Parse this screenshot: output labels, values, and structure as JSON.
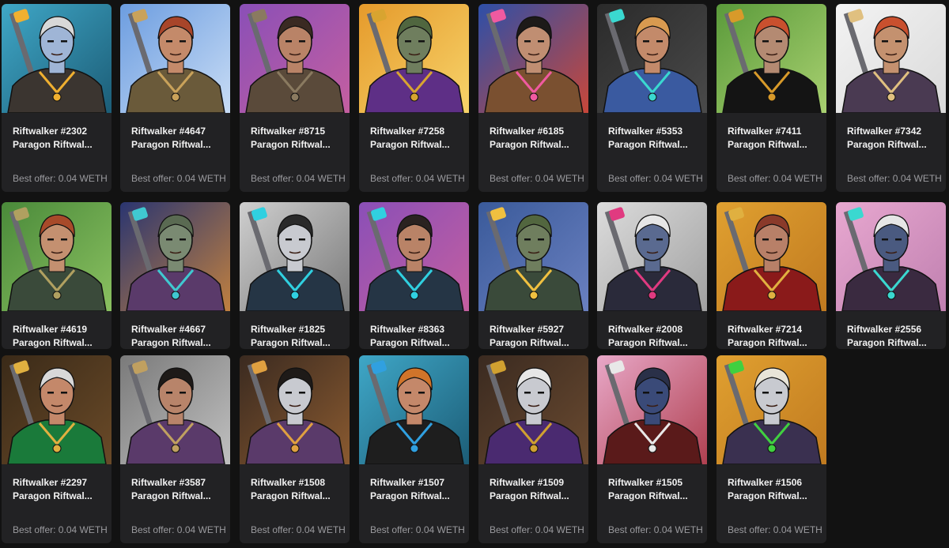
{
  "offer_prefix": "Best offer:",
  "cards": [
    {
      "title": "Riftwalker #2302",
      "subtitle": "Paragon Riftwal...",
      "offer": "Best offer: 0.04 WETH",
      "bg": "#3fa7c7",
      "bg2": "#1c5d77",
      "skin": "#9fb5d6",
      "hair": "#d8d8d8",
      "outfit": "#3b3530",
      "accent": "#f0b030"
    },
    {
      "title": "Riftwalker #4647",
      "subtitle": "Paragon Riftwal...",
      "offer": "Best offer: 0.04 WETH",
      "bg": "#6c9de0",
      "bg2": "#c8dcf5",
      "skin": "#c48a6a",
      "hair": "#a8452a",
      "outfit": "#6a5a3a",
      "accent": "#c9a25a"
    },
    {
      "title": "Riftwalker #8715",
      "subtitle": "Paragon Riftwal...",
      "offer": "Best offer: 0.04 WETH",
      "bg": "#8a4fb7",
      "bg2": "#c45fa0",
      "skin": "#b98367",
      "hair": "#3a2a22",
      "outfit": "#5a4a3a",
      "accent": "#8a7a60"
    },
    {
      "title": "Riftwalker #7258",
      "subtitle": "Paragon Riftwal...",
      "offer": "Best offer: 0.04 WETH",
      "bg": "#e59a2b",
      "bg2": "#f7d36a",
      "skin": "#6f7e5e",
      "hair": "#50663f",
      "outfit": "#5e2f86",
      "accent": "#d8a430"
    },
    {
      "title": "Riftwalker #6185",
      "subtitle": "Paragon Riftwal...",
      "offer": "Best offer: 0.04 WETH",
      "bg": "#2d4fa8",
      "bg2": "#c8473a",
      "skin": "#c08e72",
      "hair": "#1d1a18",
      "outfit": "#7a5030",
      "accent": "#f05aa0"
    },
    {
      "title": "Riftwalker #5353",
      "subtitle": "Paragon Riftwal...",
      "offer": "Best offer: 0.04 WETH",
      "bg": "#2a2a2a",
      "bg2": "#4a4a4a",
      "skin": "#c38a6a",
      "hair": "#d89a50",
      "outfit": "#3a5aa0",
      "accent": "#3ad8d0"
    },
    {
      "title": "Riftwalker #7411",
      "subtitle": "Paragon Riftwal...",
      "offer": "Best offer: 0.04 WETH",
      "bg": "#5a9a3a",
      "bg2": "#a8d070",
      "skin": "#b48a72",
      "hair": "#c9502e",
      "outfit": "#141414",
      "accent": "#d89a2a"
    },
    {
      "title": "Riftwalker #7342",
      "subtitle": "Paragon Riftwal...",
      "offer": "Best offer: 0.04 WETH",
      "bg": "#f3f3f3",
      "bg2": "#dadada",
      "skin": "#c4916f",
      "hair": "#c9502e",
      "outfit": "#4a3a52",
      "accent": "#e0c080"
    },
    {
      "title": "Riftwalker #4619",
      "subtitle": "Paragon Riftwal...",
      "offer": "",
      "bg": "#4a8a3a",
      "bg2": "#8ac060",
      "skin": "#c49070",
      "hair": "#a84a2a",
      "outfit": "#3a4a3a",
      "accent": "#b0a060"
    },
    {
      "title": "Riftwalker #4667",
      "subtitle": "Paragon Riftwal...",
      "offer": "",
      "bg": "#2a3570",
      "bg2": "#c08040",
      "skin": "#7a8a72",
      "hair": "#5a6a52",
      "outfit": "#5a3a6a",
      "accent": "#40c8d0"
    },
    {
      "title": "Riftwalker #1825",
      "subtitle": "Paragon Riftwal...",
      "offer": "",
      "bg": "#cfcfcf",
      "bg2": "#7a7a7a",
      "skin": "#c8cad0",
      "hair": "#2a2a2a",
      "outfit": "#253545",
      "accent": "#30d0e0"
    },
    {
      "title": "Riftwalker #8363",
      "subtitle": "Paragon Riftwal...",
      "offer": "",
      "bg": "#8a4fb7",
      "bg2": "#c45fa0",
      "skin": "#b98367",
      "hair": "#2a2220",
      "outfit": "#253545",
      "accent": "#30d0e0"
    },
    {
      "title": "Riftwalker #5927",
      "subtitle": "Paragon Riftwal...",
      "offer": "",
      "bg": "#3a5a9a",
      "bg2": "#6a80c0",
      "skin": "#6f7e5e",
      "hair": "#52663f",
      "outfit": "#3a4a3a",
      "accent": "#f0c040"
    },
    {
      "title": "Riftwalker #2008",
      "subtitle": "Paragon Riftwal...",
      "offer": "",
      "bg": "#dcdcdc",
      "bg2": "#a0a0a0",
      "skin": "#5a6a90",
      "hair": "#e6e6e6",
      "outfit": "#2a2a3a",
      "accent": "#e03a80"
    },
    {
      "title": "Riftwalker #7214",
      "subtitle": "Paragon Riftwal...",
      "offer": "",
      "bg": "#e0a030",
      "bg2": "#c07a20",
      "skin": "#b88068",
      "hair": "#8a3a2a",
      "outfit": "#8a1a1a",
      "accent": "#e0b040"
    },
    {
      "title": "Riftwalker #2556",
      "subtitle": "Paragon Riftwal...",
      "offer": "",
      "bg": "#e8a8d0",
      "bg2": "#c080b0",
      "skin": "#4a5a80",
      "hair": "#e6e6e6",
      "outfit": "#3a2a40",
      "accent": "#3ad8d0"
    },
    {
      "title": "Riftwalker #2297",
      "subtitle": "Paragon Riftwal...",
      "offer": "Best offer: 0.04 WETH",
      "bg": "#3a2a18",
      "bg2": "#6a4a28",
      "skin": "#c4886a",
      "hair": "#d8d8d8",
      "outfit": "#1a7a3a",
      "accent": "#e0b040"
    },
    {
      "title": "Riftwalker #3587",
      "subtitle": "Paragon Riftwal...",
      "offer": "Best offer: 0.04 WETH",
      "bg": "#7a7a7a",
      "bg2": "#c0c0c0",
      "skin": "#b8846a",
      "hair": "#1e1a18",
      "outfit": "#5a3a6a",
      "accent": "#c0a060"
    },
    {
      "title": "Riftwalker #1508",
      "subtitle": "Paragon Riftwal...",
      "offer": "Best offer: 0.04 WETH",
      "bg": "#3a2a20",
      "bg2": "#8a5a30",
      "skin": "#c8cad0",
      "hair": "#1e1a18",
      "outfit": "#5a3a6a",
      "accent": "#e0a040"
    },
    {
      "title": "Riftwalker #1507",
      "subtitle": "Paragon Riftwal...",
      "offer": "Best offer: 0.04 WETH",
      "bg": "#3fa7c7",
      "bg2": "#1c5d77",
      "skin": "#c4886a",
      "hair": "#d0742a",
      "outfit": "#1e1e1e",
      "accent": "#30a0e0"
    },
    {
      "title": "Riftwalker #1509",
      "subtitle": "Paragon Riftwal...",
      "offer": "Best offer: 0.04 WETH",
      "bg": "#3a2a20",
      "bg2": "#6a4a30",
      "skin": "#c8cad0",
      "hair": "#e6e6e6",
      "outfit": "#4a2a70",
      "accent": "#d0a030"
    },
    {
      "title": "Riftwalker #1505",
      "subtitle": "Paragon Riftwal...",
      "offer": "Best offer: 0.04 WETH",
      "bg": "#e8a8c8",
      "bg2": "#b04050",
      "skin": "#3a4a78",
      "hair": "#2a3048",
      "outfit": "#5a1a1a",
      "accent": "#e8e8e8"
    },
    {
      "title": "Riftwalker #1506",
      "subtitle": "Paragon Riftwal...",
      "offer": "Best offer: 0.04 WETH",
      "bg": "#e0a030",
      "bg2": "#c07a20",
      "skin": "#c8cad0",
      "hair": "#e8e4d8",
      "outfit": "#3a3050",
      "accent": "#40d040"
    }
  ]
}
